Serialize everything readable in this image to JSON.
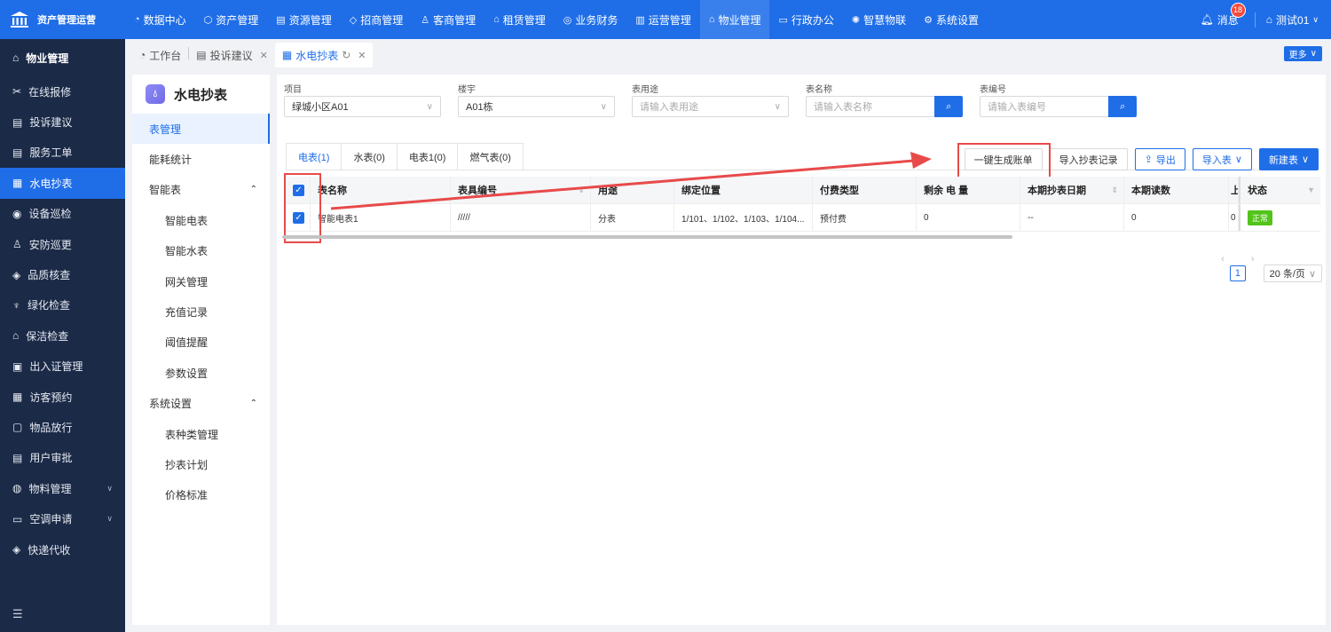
{
  "app": {
    "title": "资产管理运营"
  },
  "topnav": [
    {
      "icon": "dashboard-icon",
      "label": "数据中心"
    },
    {
      "icon": "cube-icon",
      "label": "资产管理"
    },
    {
      "icon": "building-icon",
      "label": "资源管理"
    },
    {
      "icon": "tag-icon",
      "label": "招商管理"
    },
    {
      "icon": "people-icon",
      "label": "客商管理"
    },
    {
      "icon": "house-icon",
      "label": "租赁管理"
    },
    {
      "icon": "coin-icon",
      "label": "业务财务"
    },
    {
      "icon": "chart-icon",
      "label": "运营管理"
    },
    {
      "icon": "home-icon",
      "label": "物业管理",
      "active": true
    },
    {
      "icon": "monitor-icon",
      "label": "行政办公"
    },
    {
      "icon": "iot-icon",
      "label": "智慧物联"
    },
    {
      "icon": "gear-icon",
      "label": "系统设置"
    }
  ],
  "top_right": {
    "messages_label": "消息",
    "messages_count": "18",
    "user": "测试01"
  },
  "sidebar": {
    "header": "物业管理",
    "items": [
      {
        "label": "在线报修"
      },
      {
        "label": "投诉建议"
      },
      {
        "label": "服务工单"
      },
      {
        "label": "水电抄表",
        "active": true
      },
      {
        "label": "设备巡检"
      },
      {
        "label": "安防巡更"
      },
      {
        "label": "品质核查"
      },
      {
        "label": "绿化检查"
      },
      {
        "label": "保洁检查"
      },
      {
        "label": "出入证管理"
      },
      {
        "label": "访客预约"
      },
      {
        "label": "物品放行"
      },
      {
        "label": "用户审批"
      },
      {
        "label": "物料管理",
        "caret": true
      },
      {
        "label": "空调申请",
        "caret": true
      },
      {
        "label": "快递代收"
      }
    ]
  },
  "page_tabs": [
    {
      "label": "工作台"
    },
    {
      "label": "投诉建议",
      "closable": true
    },
    {
      "label": "水电抄表",
      "active": true,
      "closable": true
    }
  ],
  "more_label": "更多",
  "submenu": {
    "title": "水电抄表",
    "items": [
      {
        "label": "表管理",
        "active": true
      },
      {
        "label": "能耗统计"
      },
      {
        "label": "智能表",
        "group": true
      },
      {
        "label": "智能电表",
        "child": true
      },
      {
        "label": "智能水表",
        "child": true
      },
      {
        "label": "网关管理",
        "child": true
      },
      {
        "label": "充值记录",
        "child": true
      },
      {
        "label": "阈值提醒",
        "child": true
      },
      {
        "label": "参数设置",
        "child": true
      },
      {
        "label": "系统设置",
        "group": true
      },
      {
        "label": "表种类管理",
        "child": true
      },
      {
        "label": "抄表计划",
        "child": true
      },
      {
        "label": "价格标准",
        "child": true
      }
    ]
  },
  "filters": {
    "project": {
      "label": "项目",
      "value": "绿城小区A01"
    },
    "building": {
      "label": "楼宇",
      "value": "A01栋"
    },
    "usage": {
      "label": "表用途",
      "placeholder": "请输入表用途"
    },
    "meter_name": {
      "label": "表名称",
      "placeholder": "请输入表名称"
    },
    "meter_no": {
      "label": "表编号",
      "placeholder": "请输入表编号"
    }
  },
  "meter_tabs": [
    {
      "label": "电表(1)",
      "active": true
    },
    {
      "label": "水表(0)"
    },
    {
      "label": "电表1(0)"
    },
    {
      "label": "燃气表(0)"
    }
  ],
  "actions": {
    "generate_bill": "一键生成账单",
    "import_records": "导入抄表记录",
    "export": "导出",
    "import_meter": "导入表",
    "new_meter": "新建表"
  },
  "table": {
    "columns": [
      "表名称",
      "表具编号",
      "用途",
      "绑定位置",
      "付费类型",
      "剩余 电 量",
      "本期抄表日期",
      "本期读数",
      "上",
      "状态"
    ],
    "rows": [
      {
        "name": "智能电表1",
        "code": "/////",
        "usage": "分表",
        "location": "1/101、1/102、1/103、1/104...",
        "pay_type": "预付费",
        "remaining": "0",
        "date": "--",
        "reading": "0",
        "prev": "0",
        "status": "正常"
      }
    ]
  },
  "pagination": {
    "current": "1",
    "page_size": "20 条/页"
  },
  "colors": {
    "primary": "#1f6ee8",
    "sidebar": "#1b2a47",
    "highlight": "#e84a4a",
    "ok": "#52c41a"
  }
}
